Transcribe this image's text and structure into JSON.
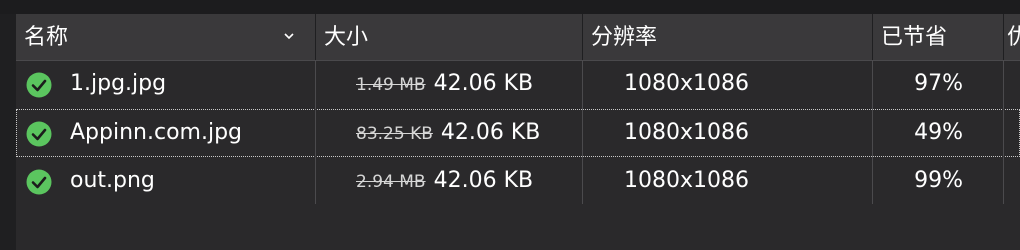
{
  "columns": {
    "name": "名称",
    "size": "大小",
    "resolution": "分辨率",
    "saved": "已节省",
    "extra": "优"
  },
  "rows": [
    {
      "status": "check-circle-icon",
      "name": "1.jpg.jpg",
      "old_size": "1.49 MB",
      "new_size": "42.06 KB",
      "resolution": "1080x1086",
      "saved": "97%"
    },
    {
      "status": "check-circle-icon",
      "name": "Appinn.com.jpg",
      "old_size": "83.25 KB",
      "new_size": "42.06 KB",
      "resolution": "1080x1086",
      "saved": "49%"
    },
    {
      "status": "check-circle-icon",
      "name": "out.png",
      "old_size": "2.94 MB",
      "new_size": "42.06 KB",
      "resolution": "1080x1086",
      "saved": "99%"
    }
  ],
  "colors": {
    "check": "#5bc55f",
    "header_bg": "#3a393b",
    "list_bg": "#2a292b"
  }
}
